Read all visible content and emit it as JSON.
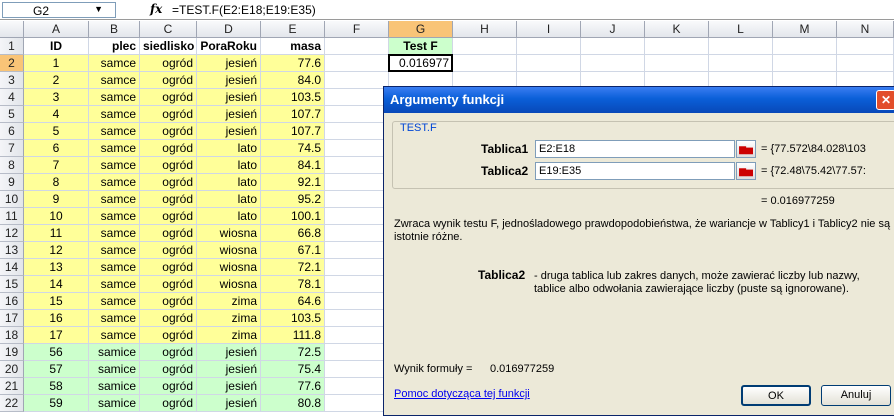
{
  "formula_bar": {
    "name_box": "G2",
    "fx_label": "fx",
    "formula": "=TEST.F(E2:E18;E19:E35)"
  },
  "columns": [
    "A",
    "B",
    "C",
    "D",
    "E",
    "F",
    "G",
    "H",
    "I",
    "J",
    "K",
    "L",
    "M",
    "N"
  ],
  "header_row": [
    "ID",
    "plec",
    "siedlisko",
    "PoraRoku",
    "masa"
  ],
  "rows": [
    {
      "n": "2",
      "id": "1",
      "plec": "samce",
      "siedlisko": "ogród",
      "pora": "jesień",
      "masa": "77.6"
    },
    {
      "n": "3",
      "id": "2",
      "plec": "samce",
      "siedlisko": "ogród",
      "pora": "jesień",
      "masa": "84.0"
    },
    {
      "n": "4",
      "id": "3",
      "plec": "samce",
      "siedlisko": "ogród",
      "pora": "jesień",
      "masa": "103.5"
    },
    {
      "n": "5",
      "id": "4",
      "plec": "samce",
      "siedlisko": "ogród",
      "pora": "jesień",
      "masa": "107.7"
    },
    {
      "n": "6",
      "id": "5",
      "plec": "samce",
      "siedlisko": "ogród",
      "pora": "jesień",
      "masa": "107.7"
    },
    {
      "n": "7",
      "id": "6",
      "plec": "samce",
      "siedlisko": "ogród",
      "pora": "lato",
      "masa": "74.5"
    },
    {
      "n": "8",
      "id": "7",
      "plec": "samce",
      "siedlisko": "ogród",
      "pora": "lato",
      "masa": "84.1"
    },
    {
      "n": "9",
      "id": "8",
      "plec": "samce",
      "siedlisko": "ogród",
      "pora": "lato",
      "masa": "92.1"
    },
    {
      "n": "10",
      "id": "9",
      "plec": "samce",
      "siedlisko": "ogród",
      "pora": "lato",
      "masa": "95.2"
    },
    {
      "n": "11",
      "id": "10",
      "plec": "samce",
      "siedlisko": "ogród",
      "pora": "lato",
      "masa": "100.1"
    },
    {
      "n": "12",
      "id": "11",
      "plec": "samce",
      "siedlisko": "ogród",
      "pora": "wiosna",
      "masa": "66.8"
    },
    {
      "n": "13",
      "id": "12",
      "plec": "samce",
      "siedlisko": "ogród",
      "pora": "wiosna",
      "masa": "67.1"
    },
    {
      "n": "14",
      "id": "13",
      "plec": "samce",
      "siedlisko": "ogród",
      "pora": "wiosna",
      "masa": "72.1"
    },
    {
      "n": "15",
      "id": "14",
      "plec": "samce",
      "siedlisko": "ogród",
      "pora": "wiosna",
      "masa": "78.1"
    },
    {
      "n": "16",
      "id": "15",
      "plec": "samce",
      "siedlisko": "ogród",
      "pora": "zima",
      "masa": "64.6"
    },
    {
      "n": "17",
      "id": "16",
      "plec": "samce",
      "siedlisko": "ogród",
      "pora": "zima",
      "masa": "103.5"
    },
    {
      "n": "18",
      "id": "17",
      "plec": "samce",
      "siedlisko": "ogród",
      "pora": "zima",
      "masa": "111.8"
    },
    {
      "n": "19",
      "id": "56",
      "plec": "samice",
      "siedlisko": "ogród",
      "pora": "jesień",
      "masa": "72.5"
    },
    {
      "n": "20",
      "id": "57",
      "plec": "samice",
      "siedlisko": "ogród",
      "pora": "jesień",
      "masa": "75.4"
    },
    {
      "n": "21",
      "id": "58",
      "plec": "samice",
      "siedlisko": "ogród",
      "pora": "jesień",
      "masa": "77.6"
    },
    {
      "n": "22",
      "id": "59",
      "plec": "samice",
      "siedlisko": "ogród",
      "pora": "jesień",
      "masa": "80.8"
    }
  ],
  "g_column": {
    "header": "Test F",
    "value": "0.016977"
  },
  "dialog": {
    "title": "Argumenty funkcji",
    "close": "✕",
    "function_name": "TEST.F",
    "arg1": {
      "label": "Tablica1",
      "value": "E2:E18",
      "result": "= {77.572\\84.028\\103"
    },
    "arg2": {
      "label": "Tablica2",
      "value": "E19:E35",
      "result": "= {72.48\\75.42\\77.57:"
    },
    "result_line": "= 0.016977259",
    "description": "Zwraca wynik testu F, jednośladowego prawdopodobieństwa, że wariancje w Tablicy1 i Tablicy2 nie są istotnie różne.",
    "param_name": "Tablica2",
    "param_desc": "- druga tablica lub zakres danych, może zawierać liczby lub nazwy, tablice albo odwołania zawierające liczby (puste są ignorowane).",
    "formula_result_label": "Wynik formuły =",
    "formula_result_value": "0.016977259",
    "help_link": "Pomoc dotycząca tej funkcji",
    "ok": "OK",
    "cancel": "Anuluj"
  }
}
